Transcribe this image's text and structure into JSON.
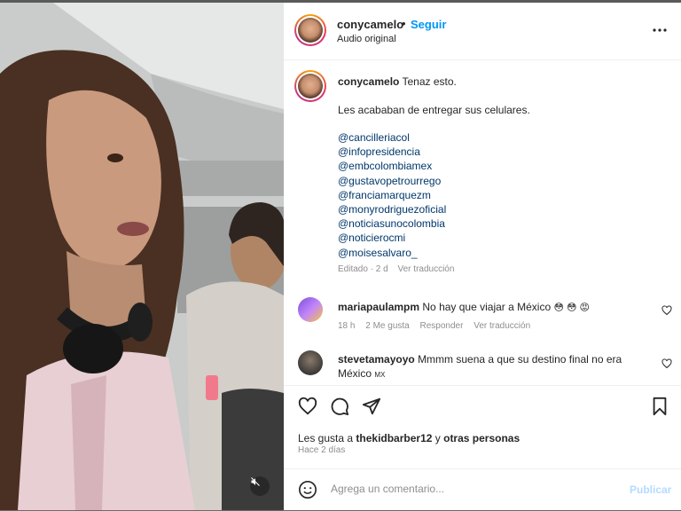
{
  "header": {
    "username": "conycamelo",
    "dot": "•",
    "follow_label": "Seguir",
    "subtitle": "Audio original",
    "more_icon": "more-options-icon"
  },
  "caption": {
    "username": "conycamelo",
    "text": "Tenaz esto.",
    "line2": "Les acababan de entregar sus celulares.",
    "mentions": [
      "@cancilleriacol",
      "@infopresidencia",
      "@embcolombiamex",
      "@gustavopetrourrego",
      "@franciamarquezm",
      "@monyrodriguezoficial",
      "@noticiasunocolombia",
      "@noticierocmi",
      "@moisesalvaro_"
    ],
    "edited": "Editado · 2 d",
    "translate": "Ver traducción"
  },
  "comments": [
    {
      "username": "mariapaulampm",
      "text": "No hay que viajar a México",
      "emojis": "😳 😳 😡",
      "time": "18 h",
      "likes": "2 Me gusta",
      "reply": "Responder",
      "translate": "Ver traducción"
    },
    {
      "username": "stevetamayoyo",
      "text": "Mmmm suena a que su destino final no era",
      "text2": "México",
      "flag": "MX"
    }
  ],
  "actions": {
    "likes_text": "Les gusta a ",
    "likes_user": "thekidbarber12",
    "likes_and": " y ",
    "likes_others": "otras personas",
    "time": "Hace 2 días"
  },
  "add_comment": {
    "placeholder": "Agrega un comentario...",
    "publish_label": "Publicar"
  },
  "colors": {
    "accent": "#0095f6",
    "mention": "#00376b",
    "muted": "#8e8e8e",
    "publish_disabled": "#b3dbff"
  }
}
